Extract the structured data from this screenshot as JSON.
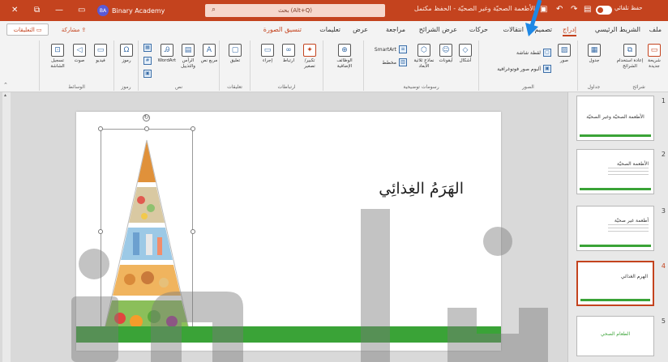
{
  "titlebar": {
    "account_name": "Binary Academy",
    "avatar_initials": "BA",
    "search_text": "(Alt+Q) بحث",
    "doc_title": "الأطعمة الصحيّة وغير الصحيّة - الحفظ مكتمل",
    "autosave_label": "حفظ تلقائي",
    "close_glyph": "✕",
    "restore_glyph": "⧉",
    "minimize_glyph": "—",
    "ribbon_display_glyph": "▭"
  },
  "tabs": {
    "file": "ملف",
    "home": "الشريط الرئيسي",
    "insert": "إدراج",
    "design": "تصميم",
    "transitions": "انتقالات",
    "animations": "حركات",
    "slideshow": "عرض الشرائح",
    "review": "مراجعة",
    "view": "عرض",
    "help": "تعليمات",
    "picture_format": "تنسيق الصورة",
    "share_label": "مشاركة",
    "comments_label": "التعليقات"
  },
  "ribbon": {
    "groups": {
      "slides": "شرائح",
      "tables": "جداول",
      "images": "الصور",
      "illustrations": "رسومات توضيحية",
      "addins": "",
      "links": "ارتباطات",
      "comments": "تعليقات",
      "text": "نص",
      "symbols": "رموز",
      "media": "الوسائط"
    },
    "buttons": {
      "new_slide": "شريحة جديدة",
      "reuse_slides": "إعادة استخدام الشرائح",
      "table": "جدول",
      "images": "صور",
      "screenshot": "لقطة شاشة",
      "photo_album": "ألبوم صور فوتوغرافية",
      "shapes": "أشكال",
      "icons": "أيقونات",
      "models_3d": "نماذج ثلاثية الأبعاد",
      "smartart": "SmartArt",
      "chart": "مخطط",
      "addins": "الوظائف الإضافية",
      "zoom": "تكبير/تصغير",
      "link": "ارتباط",
      "action": "إجراء",
      "comment": "تعليق",
      "textbox": "مربع نص",
      "header_footer": "الرأس والتذييل",
      "wordart": "WordArt",
      "symbols": "رموز",
      "video": "فيديو",
      "audio": "صوت",
      "screen_recording": "تسجيل الشاشة"
    }
  },
  "slide": {
    "title": "الهَرَمُ الغِذائِي"
  },
  "thumbnails": [
    {
      "num": "1",
      "text": "الأطعمة الصحيّة وغير الصحيّة"
    },
    {
      "num": "2",
      "text": "الأطعمة الصحيّة"
    },
    {
      "num": "3",
      "text": "أطعمة غير صحيّة"
    },
    {
      "num": "4",
      "text": "الهرم الغذائي"
    },
    {
      "num": "5",
      "text": "الطعام الصحي"
    }
  ],
  "colors": {
    "accent": "#c4431e",
    "slide_bar": "#3aa337",
    "arrow": "#1e88e5"
  }
}
